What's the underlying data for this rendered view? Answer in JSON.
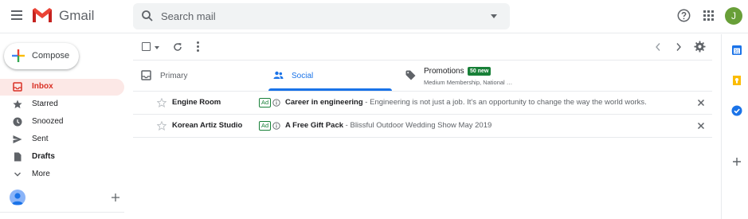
{
  "app": {
    "name": "Gmail",
    "account_initial": "J"
  },
  "search": {
    "placeholder": "Search mail"
  },
  "compose": {
    "label": "Compose"
  },
  "sidebar": {
    "items": [
      {
        "label": "Inbox",
        "icon": "inbox-icon"
      },
      {
        "label": "Starred",
        "icon": "star-icon"
      },
      {
        "label": "Snoozed",
        "icon": "clock-icon"
      },
      {
        "label": "Sent",
        "icon": "send-icon"
      },
      {
        "label": "Drafts",
        "icon": "draft-icon"
      },
      {
        "label": "More",
        "icon": "chevron-down-icon"
      }
    ]
  },
  "tabs": [
    {
      "label": "Primary",
      "icon": "inbox-icon"
    },
    {
      "label": "Social",
      "icon": "people-icon"
    },
    {
      "label": "Promotions",
      "icon": "tag-icon",
      "badge": "50 new",
      "subtitle": "Medium Membership, National …"
    }
  ],
  "emails": [
    {
      "sender": "Engine Room",
      "ad_label": "Ad",
      "subject": "Career in engineering",
      "snippet": " - Engineering is not just a job. It's an opportunity to change the way the world works."
    },
    {
      "sender": "Korean Artiz Studio",
      "ad_label": "Ad",
      "subject": "A Free Gift Pack",
      "snippet": " - Blissful Outdoor Wedding Show May 2019"
    }
  ],
  "colors": {
    "accent_red": "#d93025",
    "accent_blue": "#1a73e8",
    "badge_green": "#188038",
    "inbox_active_bg": "#fce8e6"
  }
}
